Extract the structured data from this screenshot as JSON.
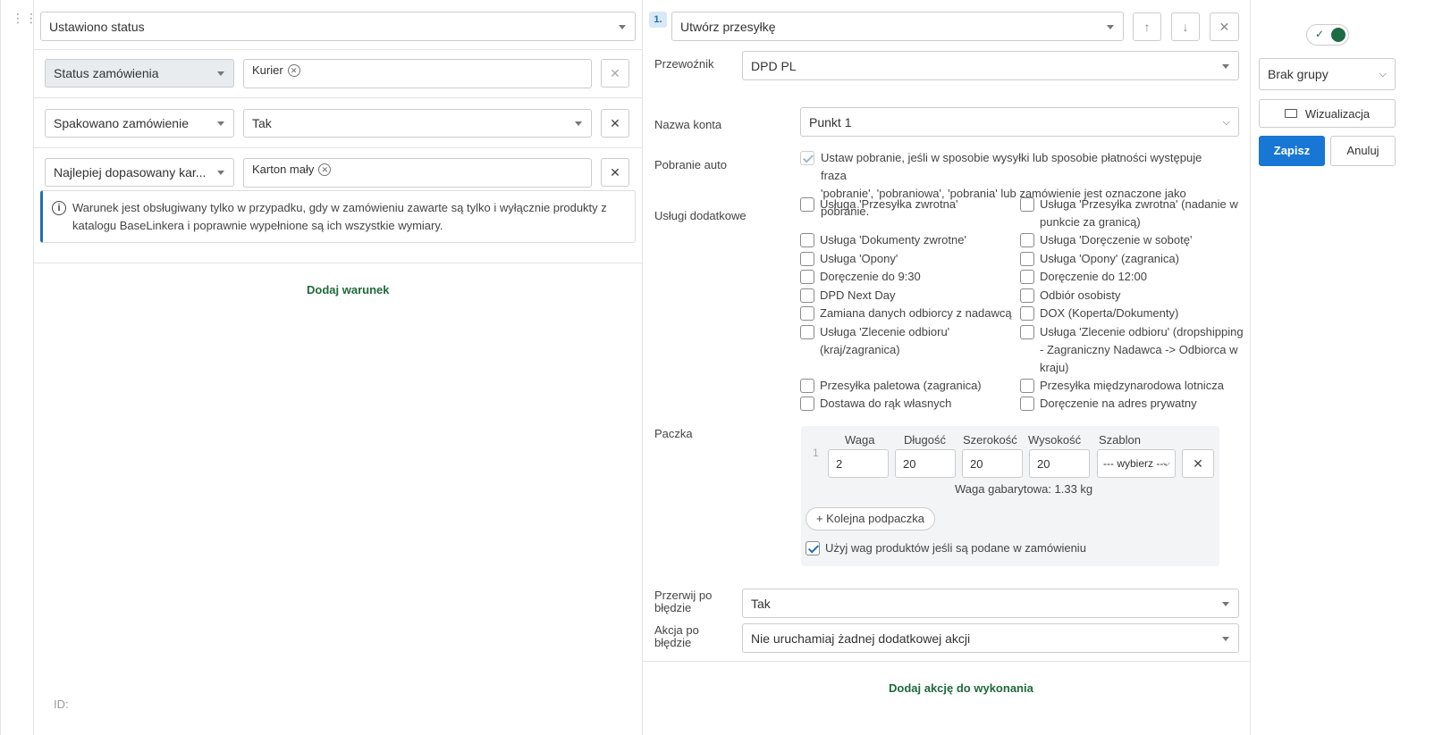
{
  "left": {
    "trigger_value": "Ustawiono status",
    "conditions": [
      {
        "field": "Status zamówienia",
        "value_tag": "Kurier"
      },
      {
        "field": "Spakowano zamówienie",
        "value": "Tak"
      },
      {
        "field": "Najlepiej dopasowany kar...",
        "value_tag": "Karton mały"
      }
    ],
    "info_text": "Warunek jest obsługiwany tylko w przypadku, gdy w zamówieniu zawarte są tylko i wyłącznie produkty z katalogu BaseLinkera i poprawnie wypełnione są ich wszystkie wymiary.",
    "add_condition": "Dodaj warunek",
    "id_label": "ID:"
  },
  "action": {
    "number": "1.",
    "type": "Utwórz przesyłkę",
    "carrier_label": "Przewoźnik",
    "carrier_value": "DPD PL",
    "account_label": "Nazwa konta",
    "account_value": "Punkt 1",
    "cod_label": "Pobranie auto",
    "cod_text_1": "Ustaw pobranie, jeśli w sposobie wysyłki lub sposobie płatności występuje fraza",
    "cod_text_2": "'pobranie', 'pobraniowa', 'pobrania' lub zamówienie jest oznaczone jako pobranie.",
    "services_label": "Usługi dodatkowe",
    "services_left": [
      [
        "Usługa 'Przesyłka zwrotna'"
      ],
      [
        "Usługa 'Dokumenty zwrotne'"
      ],
      [
        "Usługa 'Opony'"
      ],
      [
        "Doręczenie do 9:30"
      ],
      [
        "DPD Next Day"
      ],
      [
        "Zamiana danych odbiorcy z nadawcą"
      ],
      [
        "Usługa 'Zlecenie odbioru'",
        "(kraj/zagranica)"
      ],
      [
        "Przesyłka paletowa (zagranica)"
      ],
      [
        "Dostawa do rąk własnych"
      ]
    ],
    "services_right": [
      [
        "Usługa 'Przesyłka zwrotna' (nadanie w",
        "punkcie za granicą)"
      ],
      [
        "Usługa 'Doręczenie w sobotę'"
      ],
      [
        "Usługa 'Opony' (zagranica)"
      ],
      [
        "Doręczenie do 12:00"
      ],
      [
        "Odbiór osobisty"
      ],
      [
        "DOX (Koperta/Dokumenty)"
      ],
      [
        "Usługa 'Zlecenie odbioru' (dropshipping",
        "- Zagraniczny Nadawca -> Odbiorca w",
        "kraju)"
      ],
      [
        "Przesyłka międzynarodowa lotnicza"
      ],
      [
        "Doręczenie na adres prywatny"
      ]
    ],
    "package_label": "Paczka",
    "package": {
      "row_number": "1",
      "col_weight": "Waga",
      "col_length": "Długość",
      "col_width": "Szerokość",
      "col_height": "Wysokość",
      "col_template": "Szablon",
      "weight": "2",
      "length": "20",
      "width": "20",
      "height": "20",
      "template": "--- wybierz ---",
      "dim_weight": "Waga gabarytowa: 1.33 kg",
      "add_subpackage": "+ Kolejna podpaczka",
      "use_product_weights": "Użyj wag produktów jeśli są podane w zamówieniu"
    },
    "stop_label_1": "Przerwij po",
    "stop_label_2": "błędzie",
    "stop_value": "Tak",
    "err_label_1": "Akcja po",
    "err_label_2": "błędzie",
    "err_value": "Nie uruchamiaj żadnej dodatkowej akcji",
    "add_action": "Dodaj akcję do wykonania"
  },
  "right": {
    "toggle_on": true,
    "group_value": "Brak grupy",
    "visualize": "Wizualizacja",
    "save": "Zapisz",
    "cancel": "Anuluj"
  },
  "colors": {
    "primary": "#1877d5",
    "link_green": "#1e6b3a",
    "toggle_green": "#1d6b45",
    "info_bar": "#1f6fb2"
  }
}
